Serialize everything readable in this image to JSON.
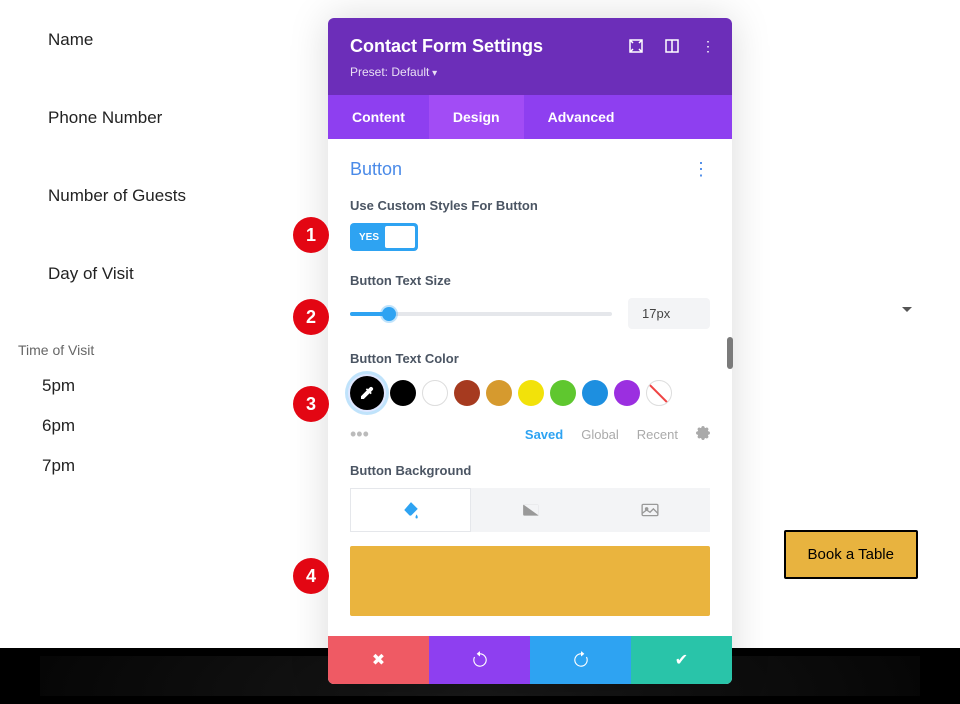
{
  "form": {
    "fields": [
      "Name",
      "Phone Number",
      "Number of Guests",
      "Day of Visit"
    ],
    "time_label": "Time of Visit",
    "time_options": [
      "5pm",
      "6pm",
      "7pm"
    ],
    "book_button": "Book a Table"
  },
  "modal": {
    "title": "Contact Form Settings",
    "preset": "Preset: Default",
    "tabs": [
      "Content",
      "Design",
      "Advanced"
    ],
    "active_tab": 1,
    "section": "Button",
    "custom_styles_label": "Use Custom Styles For Button",
    "toggle_value": "YES",
    "text_size_label": "Button Text Size",
    "text_size_value": "17px",
    "text_color_label": "Button Text Color",
    "colors": [
      "#000000",
      "#000000",
      "#ffffff",
      "#a63a1f",
      "#d69a2e",
      "#f2e20a",
      "#5fc72f",
      "#1d8fe0",
      "#9b2fe0"
    ],
    "color_tabs": {
      "saved": "Saved",
      "global": "Global",
      "recent": "Recent"
    },
    "bg_label": "Button Background",
    "bg_preview_color": "#eab43e"
  },
  "markers": [
    "1",
    "2",
    "3",
    "4"
  ]
}
